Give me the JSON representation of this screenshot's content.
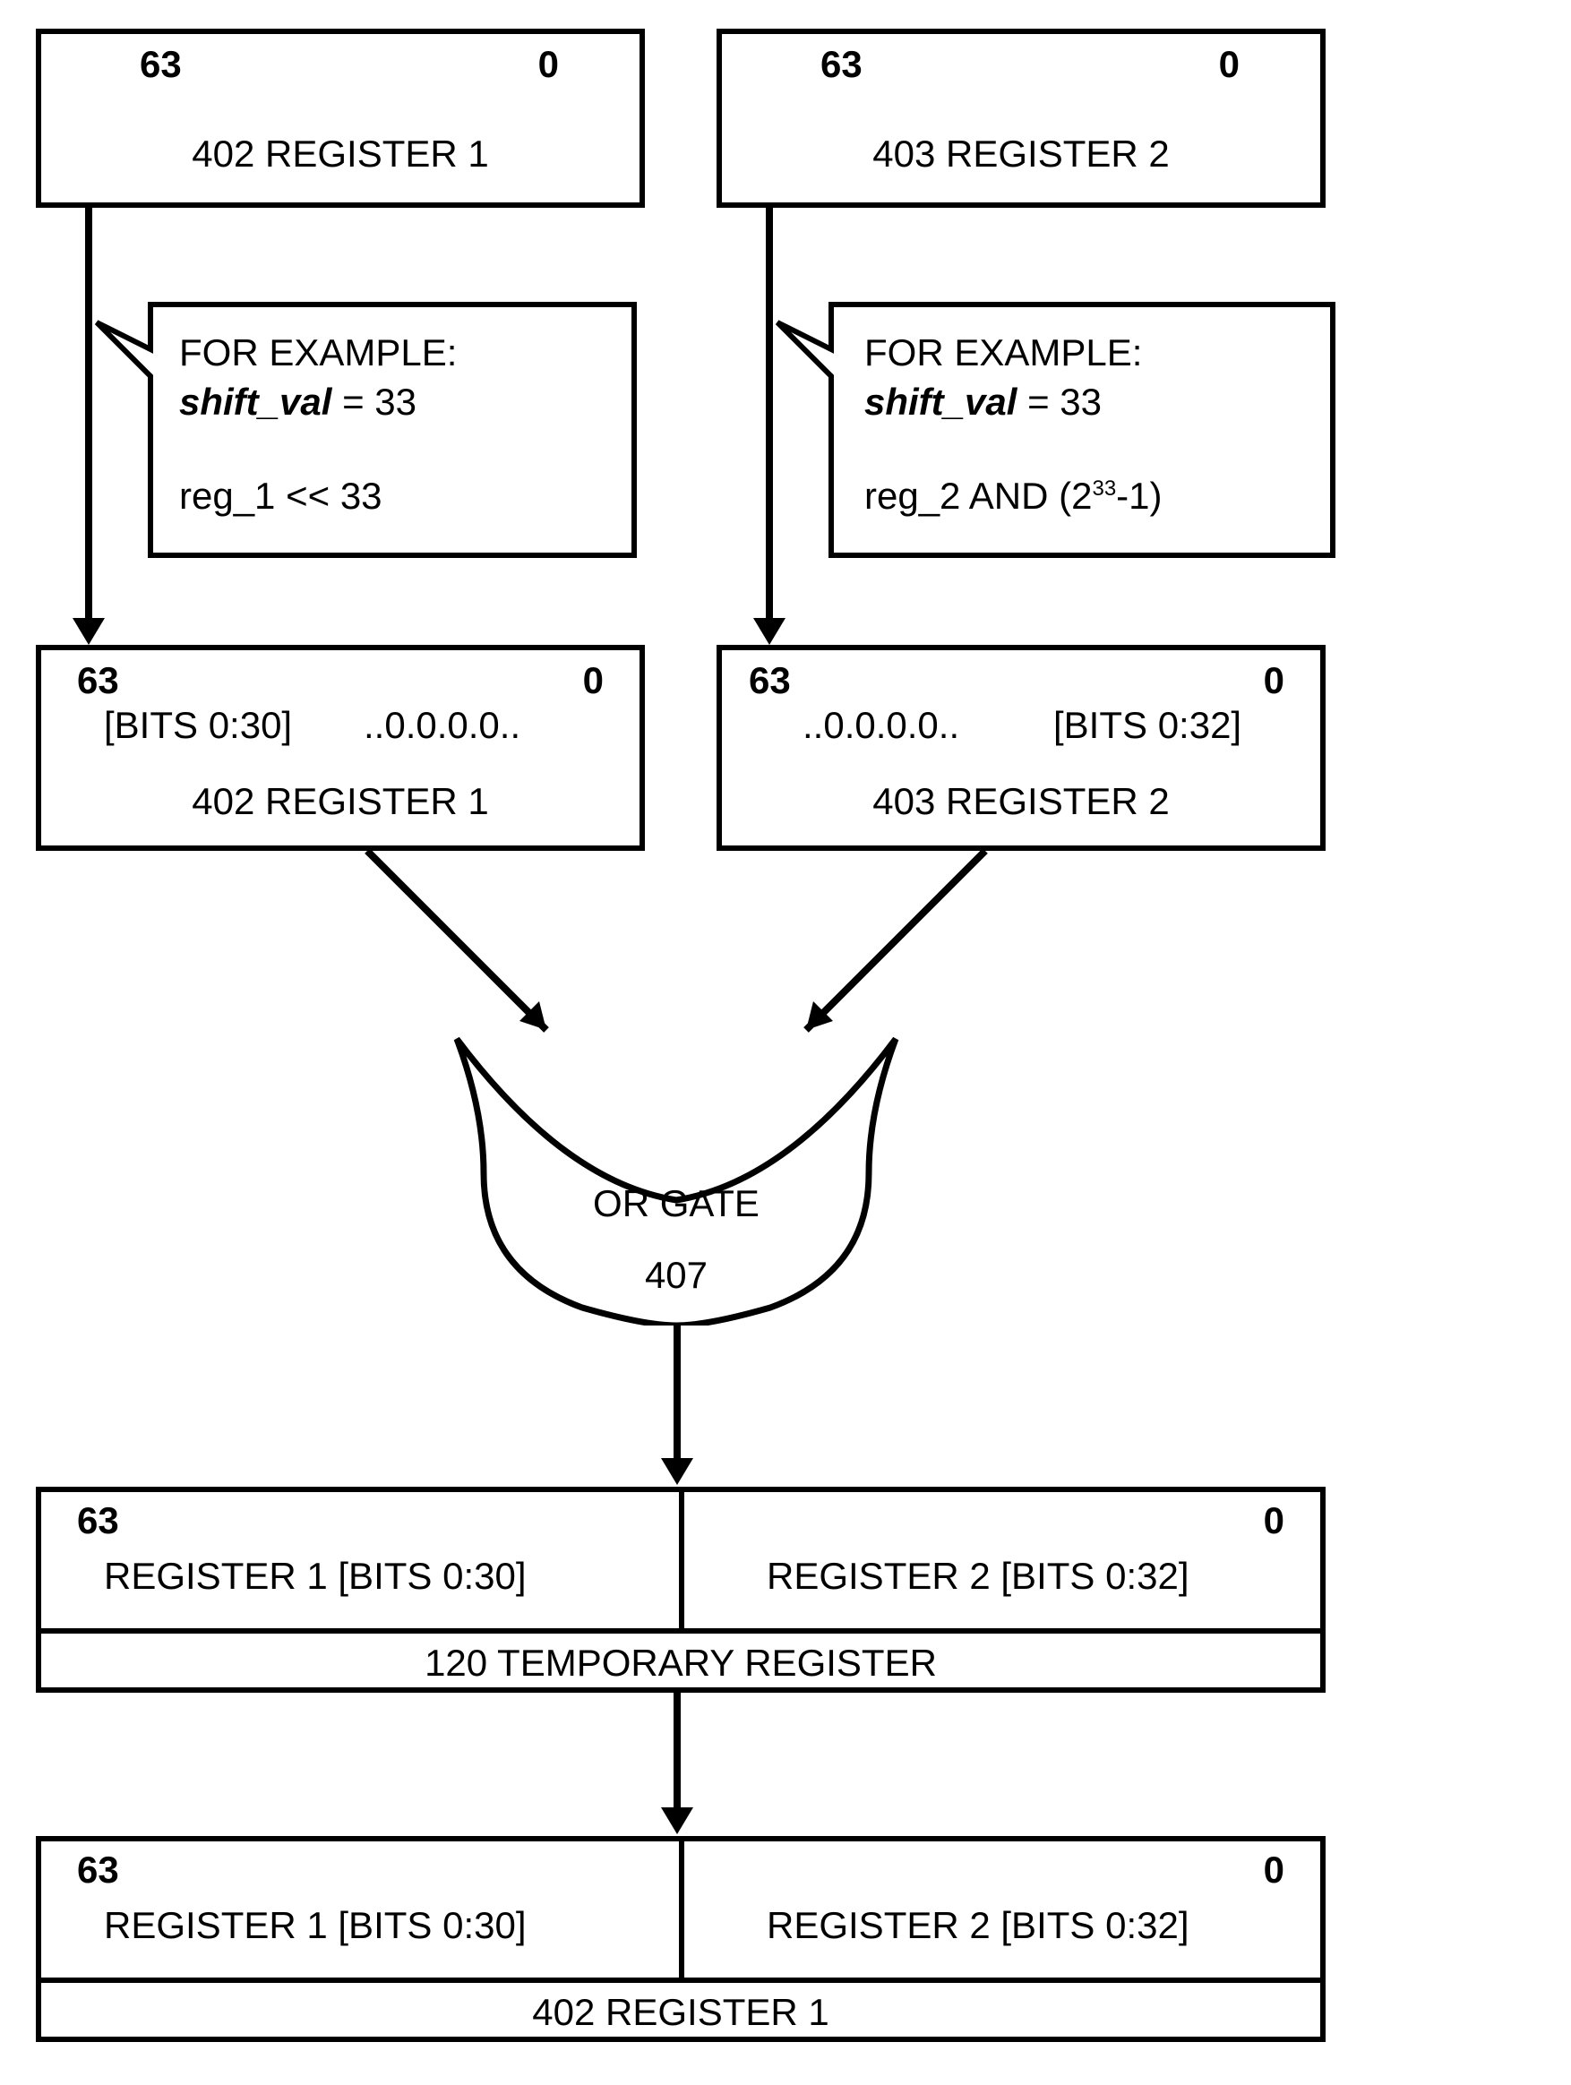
{
  "reg1_top": {
    "bit_hi": "63",
    "bit_lo": "0",
    "label": "402  REGISTER 1"
  },
  "reg2_top": {
    "bit_hi": "63",
    "bit_lo": "0",
    "label": "403  REGISTER 2"
  },
  "callout_left": {
    "line1": "FOR EXAMPLE:",
    "line2_pre": "shift_val",
    "line2_post": " = 33",
    "line3": "reg_1 <<  33"
  },
  "callout_right": {
    "line1": "FOR EXAMPLE:",
    "line2_pre": "shift_val",
    "line2_post": " = 33",
    "line3_a": "reg_2 AND (2",
    "line3_exp": "33",
    "line3_b": "-1)"
  },
  "reg1_mid": {
    "bit_hi": "63",
    "bit_lo": "0",
    "content_left": "[BITS 0:30]",
    "content_right": "..0.0.0.0..",
    "label": "402  REGISTER 1"
  },
  "reg2_mid": {
    "bit_hi": "63",
    "bit_lo": "0",
    "content_left": "..0.0.0.0..",
    "content_right": "[BITS 0:32]",
    "label": "403  REGISTER 2"
  },
  "or_gate": {
    "label1": "OR GATE",
    "label2": "407"
  },
  "temp_reg": {
    "bit_hi": "63",
    "bit_lo": "0",
    "left": "REGISTER 1 [BITS 0:30]",
    "right": "REGISTER 2 [BITS 0:32]",
    "label": "120  TEMPORARY REGISTER"
  },
  "final_reg": {
    "bit_hi": "63",
    "bit_lo": "0",
    "left": "REGISTER 1 [BITS 0:30]",
    "right": "REGISTER 2 [BITS 0:32]",
    "label": "402 REGISTER   1"
  }
}
